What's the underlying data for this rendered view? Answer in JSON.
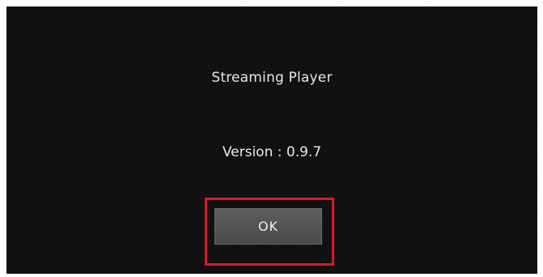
{
  "dialog": {
    "title": "Streaming Player",
    "version_text": "Version : 0.9.7",
    "ok_label": "OK"
  },
  "colors": {
    "background": "#0e0e0e",
    "text": "#e8e8e8",
    "button": "#555555",
    "highlight": "#d7192c"
  }
}
